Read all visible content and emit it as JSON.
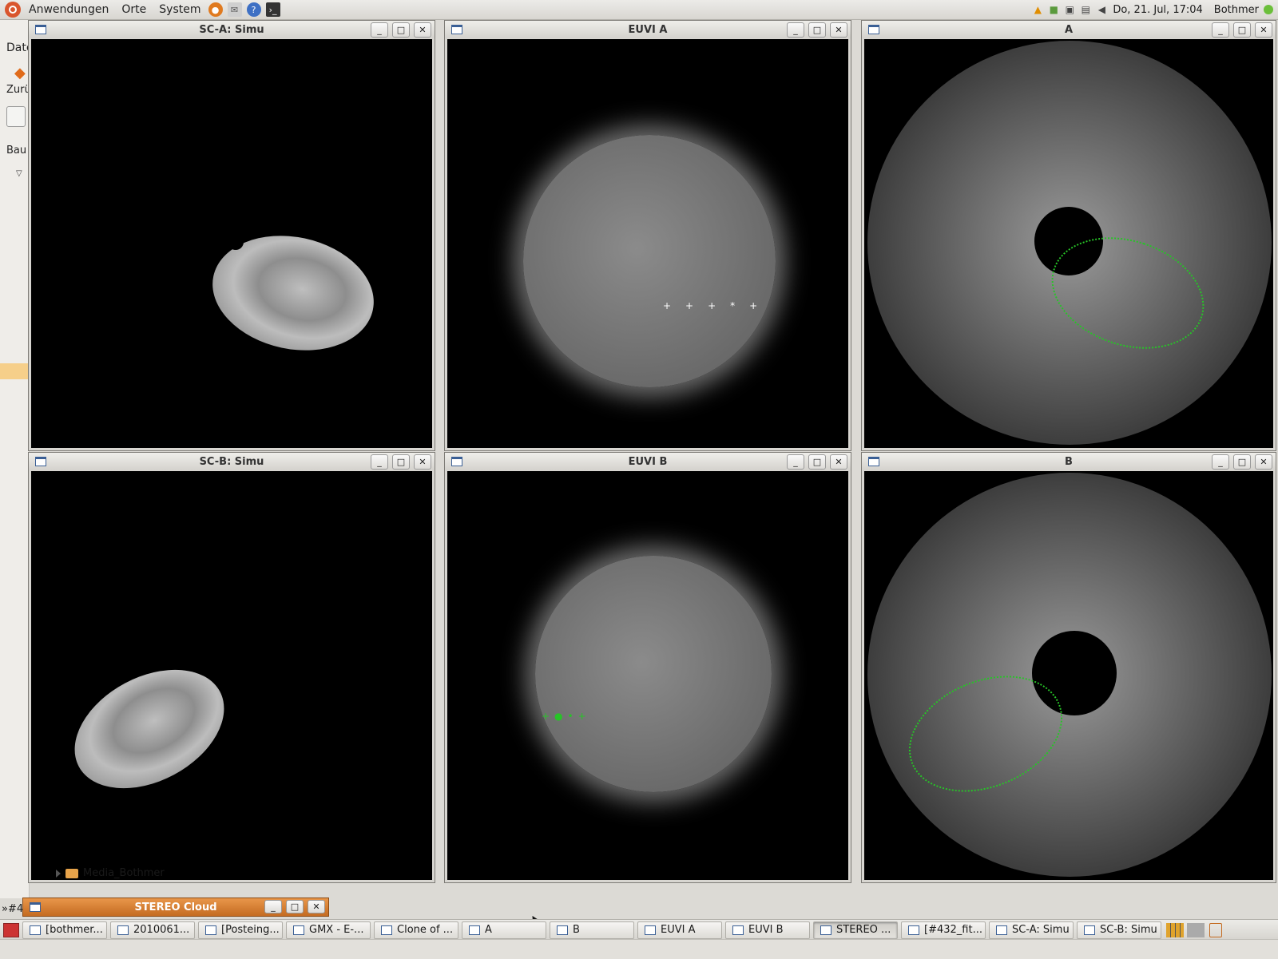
{
  "top_panel": {
    "menus": [
      "Anwendungen",
      "Orte",
      "System"
    ],
    "launchers": [
      "firefox-icon",
      "mail-icon",
      "help-icon",
      "terminal-icon"
    ],
    "clock": "Do, 21. Jul, 17:04",
    "user": "Bothmer"
  },
  "background_window": {
    "fragments": [
      "Date",
      "Zurü",
      "Bau"
    ],
    "folder_label": "Media_Bothmer"
  },
  "windows": [
    {
      "id": "sc-a-simu",
      "title": "SC-A: Simu"
    },
    {
      "id": "euvi-a",
      "title": "EUVI A"
    },
    {
      "id": "cor-a",
      "title": "A"
    },
    {
      "id": "sc-b-simu",
      "title": "SC-B: Simu"
    },
    {
      "id": "euvi-b",
      "title": "EUVI B"
    },
    {
      "id": "cor-b",
      "title": "B"
    }
  ],
  "stereo_cloud": {
    "title": "STEREO Cloud"
  },
  "taskbar": {
    "prefix": "»#4",
    "items": [
      "[bothmer...",
      "2010061...",
      "[Posteing...",
      "GMX - E-...",
      "Clone of ...",
      "A",
      "B",
      "EUVI A",
      "EUVI B",
      "STEREO ...",
      "[#432_fit...",
      "SC-A: Simu",
      "SC-B: Simu"
    ],
    "active_index": 9
  },
  "colors": {
    "panel": "#dcdad5",
    "overlay_green": "#27c427",
    "stereo_titlebar": "#d9803a"
  }
}
